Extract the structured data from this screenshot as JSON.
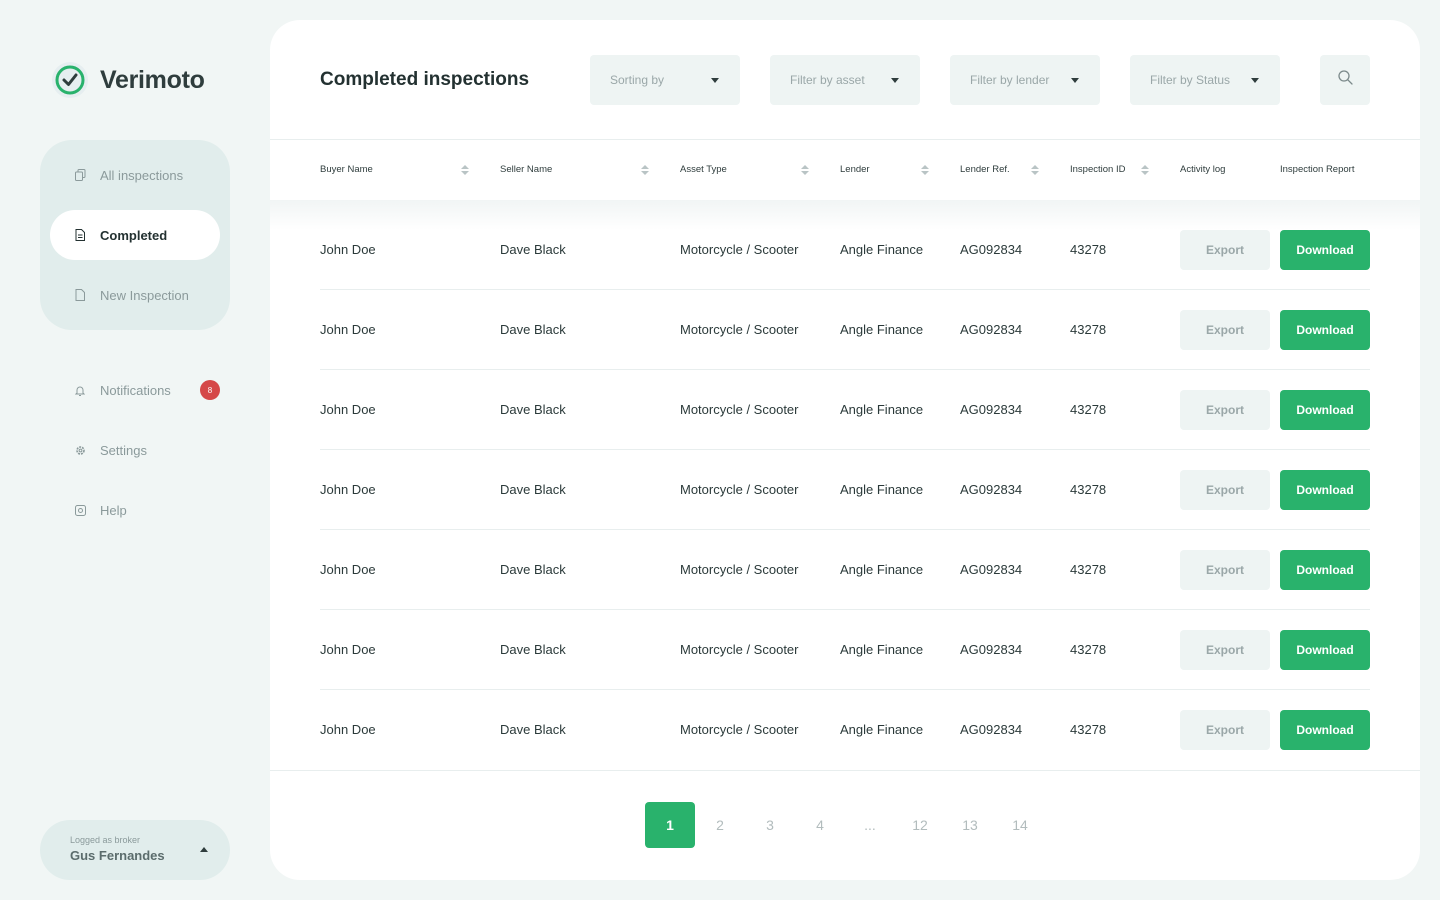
{
  "brand": {
    "name": "Verimoto",
    "accent": "#29b26c"
  },
  "sidebar": {
    "primary": [
      {
        "label": "All inspections",
        "icon": "copy-icon",
        "active": false
      },
      {
        "label": "Completed",
        "icon": "document-icon",
        "active": true
      },
      {
        "label": "New Inspection",
        "icon": "file-icon",
        "active": false
      }
    ],
    "secondary": [
      {
        "label": "Notifications",
        "icon": "bell-icon",
        "badge": "8"
      },
      {
        "label": "Settings",
        "icon": "gear-icon"
      },
      {
        "label": "Help",
        "icon": "help-icon"
      }
    ],
    "user": {
      "role": "Logged as broker",
      "name": "Gus Fernandes"
    }
  },
  "main": {
    "title": "Completed inspections",
    "filters": [
      {
        "placeholder": "Sorting by"
      },
      {
        "placeholder": "Filter by asset"
      },
      {
        "placeholder": "Filter by lender"
      },
      {
        "placeholder": "Filter by Status"
      }
    ],
    "columns": [
      {
        "label": "Buyer Name",
        "sortable": true
      },
      {
        "label": "Seller Name",
        "sortable": true
      },
      {
        "label": "Asset Type",
        "sortable": true
      },
      {
        "label": "Lender",
        "sortable": true
      },
      {
        "label": "Lender Ref.",
        "sortable": true
      },
      {
        "label": "Inspection ID",
        "sortable": true
      },
      {
        "label": "Activity log",
        "sortable": false
      },
      {
        "label": "Inspection Report",
        "sortable": false
      }
    ],
    "rows": [
      {
        "buyer": "John Doe",
        "seller": "Dave Black",
        "asset": "Motorcycle / Scooter",
        "lender": "Angle Finance",
        "ref": "AG092834",
        "id": "43278",
        "export": "Export",
        "download": "Download"
      },
      {
        "buyer": "John Doe",
        "seller": "Dave Black",
        "asset": "Motorcycle / Scooter",
        "lender": "Angle Finance",
        "ref": "AG092834",
        "id": "43278",
        "export": "Export",
        "download": "Download"
      },
      {
        "buyer": "John Doe",
        "seller": "Dave Black",
        "asset": "Motorcycle / Scooter",
        "lender": "Angle Finance",
        "ref": "AG092834",
        "id": "43278",
        "export": "Export",
        "download": "Download"
      },
      {
        "buyer": "John Doe",
        "seller": "Dave Black",
        "asset": "Motorcycle / Scooter",
        "lender": "Angle Finance",
        "ref": "AG092834",
        "id": "43278",
        "export": "Export",
        "download": "Download"
      },
      {
        "buyer": "John Doe",
        "seller": "Dave Black",
        "asset": "Motorcycle / Scooter",
        "lender": "Angle Finance",
        "ref": "AG092834",
        "id": "43278",
        "export": "Export",
        "download": "Download"
      },
      {
        "buyer": "John Doe",
        "seller": "Dave Black",
        "asset": "Motorcycle / Scooter",
        "lender": "Angle Finance",
        "ref": "AG092834",
        "id": "43278",
        "export": "Export",
        "download": "Download"
      },
      {
        "buyer": "John Doe",
        "seller": "Dave Black",
        "asset": "Motorcycle / Scooter",
        "lender": "Angle Finance",
        "ref": "AG092834",
        "id": "43278",
        "export": "Export",
        "download": "Download"
      }
    ],
    "pagination": {
      "pages": [
        "1",
        "2",
        "3",
        "4",
        "...",
        "12",
        "13",
        "14"
      ],
      "current": "1"
    }
  }
}
